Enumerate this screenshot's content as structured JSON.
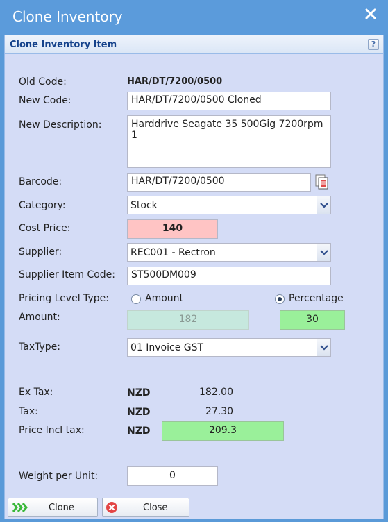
{
  "window": {
    "title": "Clone Inventory"
  },
  "panel": {
    "title": "Clone Inventory Item",
    "help": "?"
  },
  "fields": {
    "old_code_label": "Old Code:",
    "old_code": "HAR/DT/7200/0500",
    "new_code_label": "New Code:",
    "new_code": "HAR/DT/7200/0500 Cloned",
    "new_desc_label": "New Description:",
    "new_desc": "Harddrive Seagate 35 500Gig 7200rpm 1",
    "barcode_label": "Barcode:",
    "barcode": "HAR/DT/7200/0500",
    "category_label": "Category:",
    "category": "Stock",
    "cost_label": "Cost Price:",
    "cost": "140",
    "supplier_label": "Supplier:",
    "supplier": "REC001 - Rectron",
    "supplier_code_label": "Supplier Item Code:",
    "supplier_code": "ST500DM009",
    "pricing_label": "Pricing Level Type:",
    "opt_amount": "Amount",
    "opt_percentage": "Percentage",
    "amount_label": "Amount:",
    "amount": "182",
    "percentage": "30",
    "taxtype_label": "TaxType:",
    "taxtype": "01 Invoice GST",
    "extax_label": "Ex Tax:",
    "extax_cur": "NZD",
    "extax": "182.00",
    "tax_label": "Tax:",
    "tax_cur": "NZD",
    "tax": "27.30",
    "incl_label": "Price Incl tax:",
    "incl_cur": "NZD",
    "incl": "209.3",
    "weight_label": "Weight per Unit:",
    "weight": "0"
  },
  "buttons": {
    "clone": "Clone",
    "close": "Close"
  },
  "colors": {
    "cost_bg": "#ffc4c4",
    "green_bg": "#9af09a",
    "disabled_bg": "#c6e8de"
  }
}
